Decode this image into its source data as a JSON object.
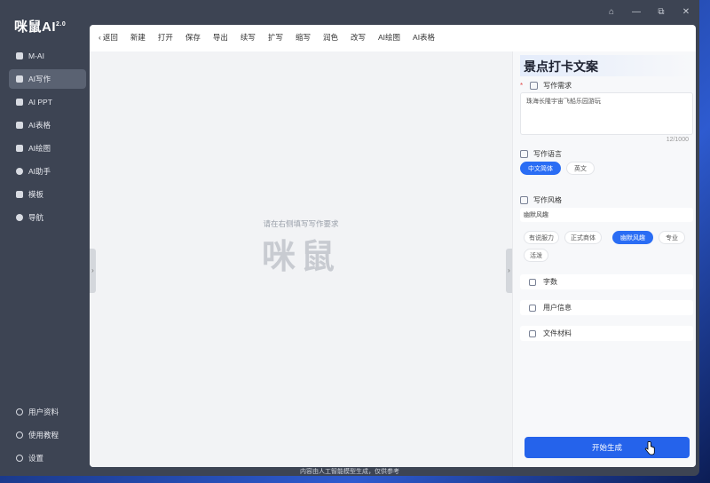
{
  "app": {
    "logo": "咪鼠AI",
    "version": "2.0",
    "window_controls": [
      "bell-icon",
      "minimize-icon",
      "restore-icon",
      "close-icon"
    ]
  },
  "sidebar": {
    "items": [
      {
        "label": "M-AI",
        "icon": "chat-icon",
        "active": false
      },
      {
        "label": "AI写作",
        "icon": "doc-icon",
        "active": true
      },
      {
        "label": "AI PPT",
        "icon": "ppt-icon",
        "active": false
      },
      {
        "label": "AI表格",
        "icon": "table-icon",
        "active": false
      },
      {
        "label": "AI绘图",
        "icon": "image-icon",
        "active": false
      },
      {
        "label": "AI助手",
        "icon": "assistant-icon",
        "active": false
      },
      {
        "label": "模板",
        "icon": "template-icon",
        "active": false
      },
      {
        "label": "导航",
        "icon": "compass-icon",
        "active": false
      }
    ],
    "bottom": [
      {
        "label": "用户资料",
        "icon": "user-icon"
      },
      {
        "label": "使用教程",
        "icon": "help-icon"
      },
      {
        "label": "设置",
        "icon": "gear-icon"
      }
    ]
  },
  "toolbar": {
    "back": "返回",
    "items": [
      "新建",
      "打开",
      "保存",
      "导出",
      "续写",
      "扩写",
      "缩写",
      "润色",
      "改写",
      "AI绘图",
      "AI表格"
    ]
  },
  "canvas": {
    "hint": "请在右侧填写写作要求",
    "watermark": "咪鼠"
  },
  "panel": {
    "title": "景点打卡文案",
    "requirement_label": "写作需求",
    "requirement_value": "珠海长隆宇宙飞船乐园游玩",
    "counter": "12/1000",
    "language_label": "写作语言",
    "languages": [
      {
        "label": "中文简体",
        "selected": true
      },
      {
        "label": "英文",
        "selected": false
      }
    ],
    "style_label": "写作风格",
    "style_value": "幽默风趣",
    "styles": [
      {
        "label": "有说服力",
        "selected": false
      },
      {
        "label": "正式商体",
        "selected": false
      },
      {
        "label": "幽默风趣",
        "selected": true
      },
      {
        "label": "专业",
        "selected": false
      },
      {
        "label": "活泼",
        "selected": false
      }
    ],
    "sections": [
      {
        "label": "字数",
        "icon": "wordcount-icon"
      },
      {
        "label": "用户信息",
        "icon": "id-card-icon"
      },
      {
        "label": "文件材料",
        "icon": "file-icon"
      }
    ],
    "generate_button": "开始生成"
  },
  "footer": "内容由人工智能模型生成，仅供参考"
}
